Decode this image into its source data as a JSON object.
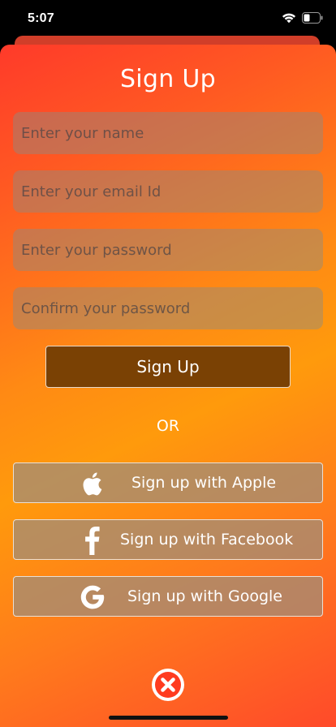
{
  "status_bar": {
    "time": "5:07"
  },
  "form": {
    "title": "Sign Up",
    "name_placeholder": "Enter your name",
    "email_placeholder": "Enter your email Id",
    "password_placeholder": "Enter your password",
    "confirm_placeholder": "Confirm your password",
    "submit_label": "Sign Up"
  },
  "divider_text": "OR",
  "social": {
    "apple_label": "Sign up with Apple",
    "facebook_label": "Sign up with Facebook",
    "google_label": "Sign up with Google"
  },
  "icons": [
    "wifi-icon",
    "battery-icon",
    "apple-icon",
    "facebook-icon",
    "google-icon",
    "close-icon"
  ],
  "colors": {
    "gradient_red": "#ff3a2a",
    "gradient_orange": "#ff9a0c",
    "submit_button": "#7a4104",
    "close_icon": "#ff3b1f"
  }
}
